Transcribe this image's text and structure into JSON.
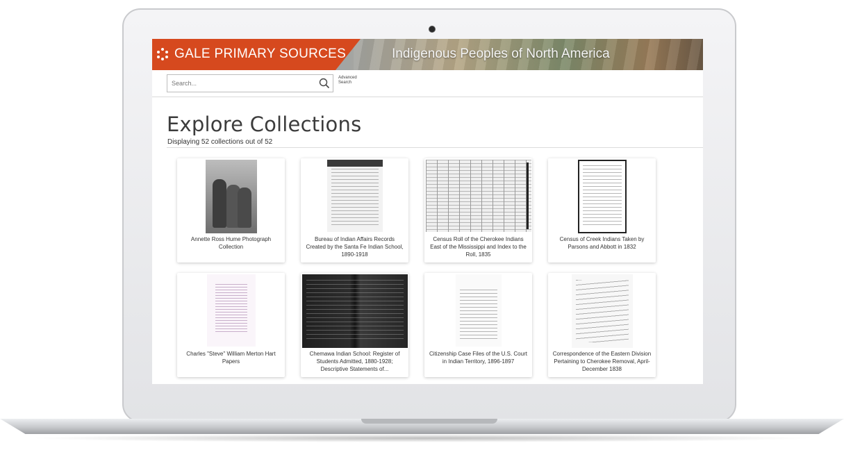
{
  "header": {
    "brand": "GALE PRIMARY SOURCES",
    "collection_title": "Indigenous Peoples of North America",
    "brand_color": "#d6491e"
  },
  "search": {
    "placeholder": "Search...",
    "advanced_label": "Advanced Search"
  },
  "main": {
    "title": "Explore Collections",
    "count_text": "Displaying 52 collections out of 52"
  },
  "collections": [
    {
      "title": "Annette Ross Hume Photograph Collection",
      "thumb": "photograph"
    },
    {
      "title": "Bureau of Indian Affairs Records Created by the Santa Fe Indian School, 1890-1918",
      "thumb": "typed-document"
    },
    {
      "title": "Census Roll of the Cherokee Indians East of the Mississippi and Index to the Roll, 1835",
      "thumb": "ledger-grid"
    },
    {
      "title": "Census of Creek Indians Taken by Parsons and Abbott in 1832",
      "thumb": "framed-list"
    },
    {
      "title": "Charles \"Steve\" William Merton Hart Papers",
      "thumb": "typed-page"
    },
    {
      "title": "Chemawa Indian School: Register of Students Admitted, 1880-1928; Descriptive Statements of...",
      "thumb": "dark-register"
    },
    {
      "title": "Citizenship Case Files of the U.S. Court in Indian Territory, 1896-1897",
      "thumb": "typed-document"
    },
    {
      "title": "Correspondence of the Eastern Division Pertaining to Cherokee Removal, April-December 1838",
      "thumb": "handwritten-letter"
    }
  ]
}
